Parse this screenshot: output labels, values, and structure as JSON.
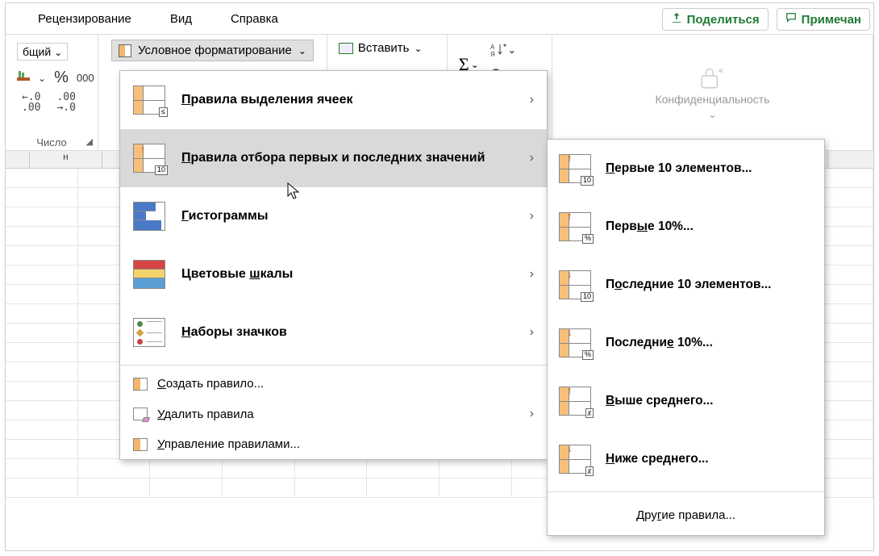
{
  "tabs": {
    "review": "Рецензирование",
    "view": "Вид",
    "help": "Справка"
  },
  "share": {
    "label": "Поделиться"
  },
  "comments": {
    "label": "Примечан"
  },
  "number_group": {
    "format_name": "бщий",
    "percent": "%",
    "thousands": "000",
    "dec1": ".0\n.00",
    "dec2": ".00\n→.0",
    "label": "Число"
  },
  "cond_fmt": {
    "button": "Условное форматирование"
  },
  "insert": {
    "label": "Вставить"
  },
  "sigma": "Σ",
  "conf": {
    "label": "Конфиденциальность"
  },
  "menu1": {
    "highlight": "Правила выделения ячеек",
    "top_bottom": "Правила отбора первых и последних значений",
    "data_bars": "Гистограммы",
    "color_scales": "Цветовые шкалы",
    "icon_sets": "Наборы значков",
    "new_rule": "Создать правило...",
    "clear": "Удалить правила",
    "manage": "Управление правилами...",
    "u_highlight": "П",
    "u_top": "П",
    "u_bars": "Г",
    "u_scales": "ш",
    "u_icons": "Н",
    "u_new": "С",
    "u_clear": "У",
    "u_manage": "У"
  },
  "menu2": {
    "top10": "Первые 10 элементов...",
    "top10p": "Первые 10%...",
    "bot10": "Последние 10 элементов...",
    "bot10p": "Последние 10%...",
    "above": "Выше среднего...",
    "below": "Ниже среднего...",
    "more": "Другие правила...",
    "u_top10": "П",
    "u_top10p": "ы",
    "u_bot10": "о",
    "u_bot10p": "е",
    "u_above": "В",
    "u_below": "Н",
    "u_more": "г"
  },
  "col_h": "н",
  "badge_10": "10",
  "badge_pct": "%",
  "badge_xbar": "x̄",
  "badge_lte": "≤"
}
